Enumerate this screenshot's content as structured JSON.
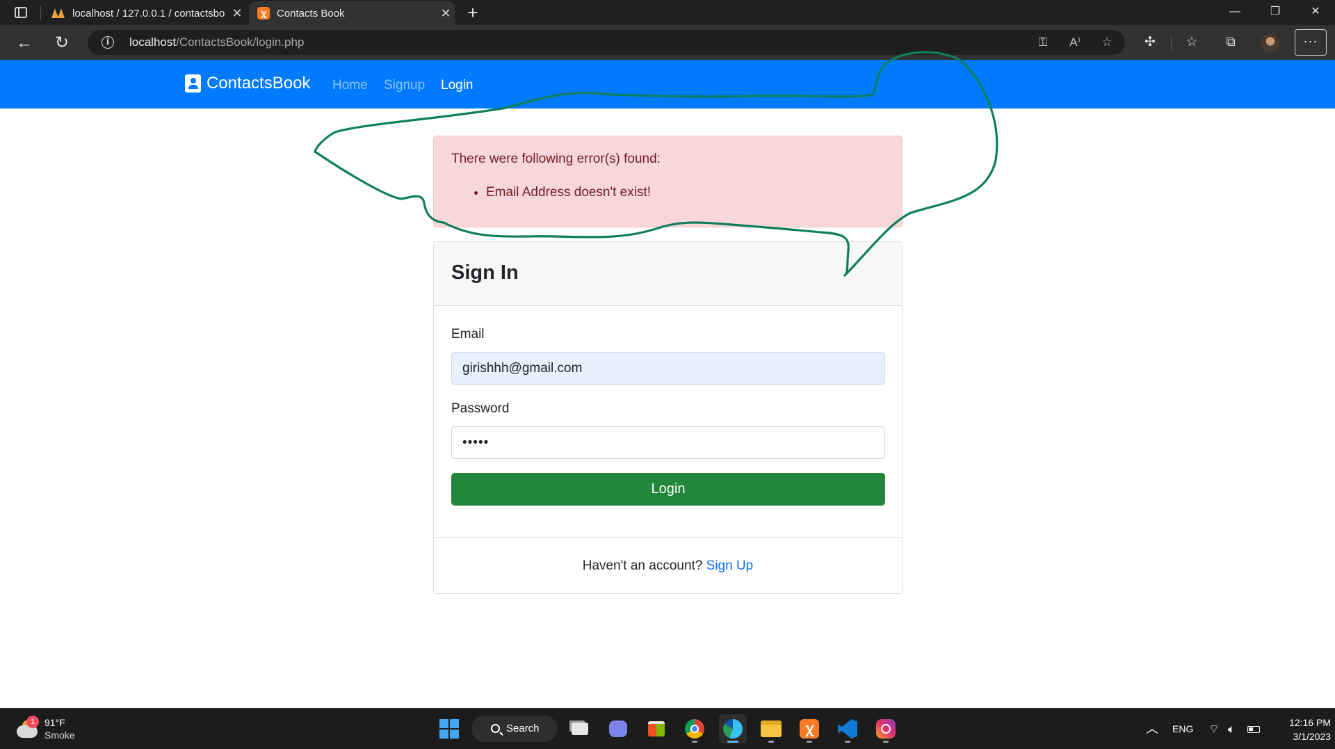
{
  "browser": {
    "tabs": [
      {
        "title": "localhost / 127.0.0.1 / contactsbo",
        "icon": "phpmyadmin-icon"
      },
      {
        "title": "Contacts Book",
        "icon": "xampp-icon",
        "active": true
      }
    ],
    "url_host": "localhost",
    "url_path": "/ContactsBook/login.php"
  },
  "navbar": {
    "brand": "ContactsBook",
    "links": [
      "Home",
      "Signup",
      "Login"
    ],
    "active_link": "Login",
    "color": "#007bff"
  },
  "alert": {
    "heading": "There were following error(s) found:",
    "errors": [
      "Email Address doesn't exist!"
    ]
  },
  "card": {
    "title": "Sign In",
    "email_label": "Email",
    "email_value": "girishhh@gmail.com",
    "password_label": "Password",
    "password_value": "•••••",
    "submit_label": "Login",
    "footer_text": "Haven't an account?",
    "footer_link": "Sign Up"
  },
  "taskbar": {
    "weather_temp": "91°F",
    "weather_condition": "Smoke",
    "weather_badge": "1",
    "search_label": "Search",
    "language": "ENG",
    "time": "12:16 PM",
    "date": "3/1/2023"
  },
  "colors": {
    "accent": "#007bff",
    "success": "#22873a",
    "danger_bg": "#f8d7da",
    "annotation": "#0e7f5a"
  }
}
